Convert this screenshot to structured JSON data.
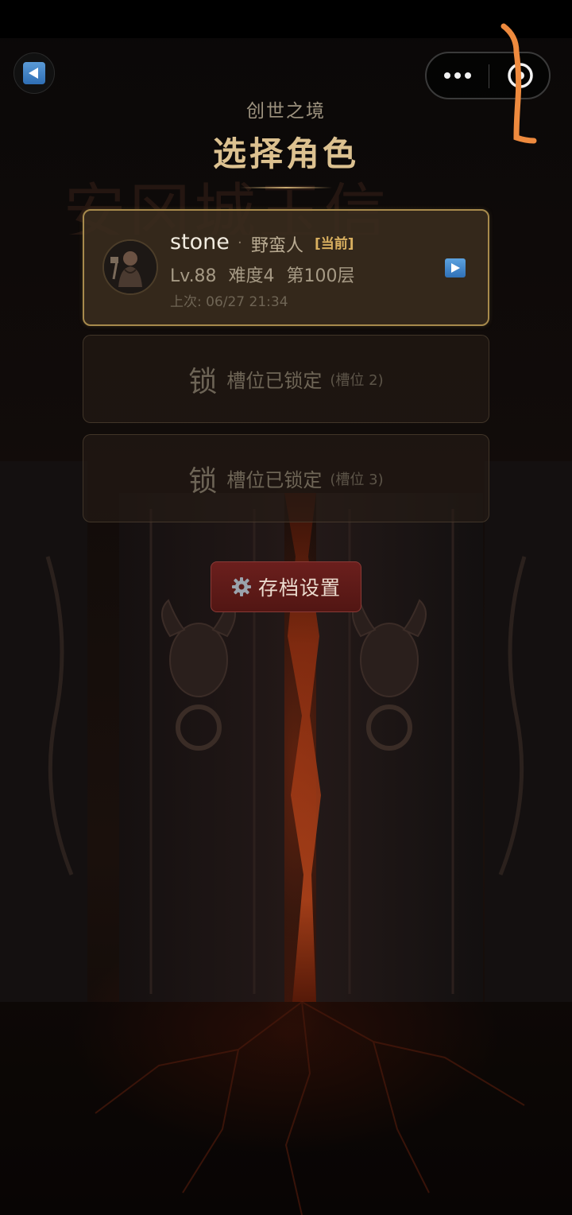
{
  "header": {
    "subtitle": "创世之境",
    "title": "选择角色",
    "background_title": "安冈城玉信"
  },
  "character": {
    "name": "stone",
    "separator": "·",
    "class": "野蛮人",
    "badge": "[当前]",
    "stats": "Lv.88 难度4 第100层",
    "last_played": "上次: 06/27 21:34"
  },
  "slots": [
    {
      "lock": "锁",
      "text": "槽位已锁定",
      "number": "(槽位 2)"
    },
    {
      "lock": "锁",
      "text": "槽位已锁定",
      "number": "(槽位 3)"
    }
  ],
  "settings_button": {
    "label": "存档设置",
    "icon": "gear-icon"
  },
  "icons": {
    "back": "back-arrow-icon",
    "play": "play-icon",
    "more": "more-dots-icon",
    "close": "target-close-icon"
  },
  "colors": {
    "accent_gold": "#dcc190",
    "card_border": "#a78a4c",
    "button_red": "#6b1f1d",
    "badge_gold": "#d9b060"
  }
}
